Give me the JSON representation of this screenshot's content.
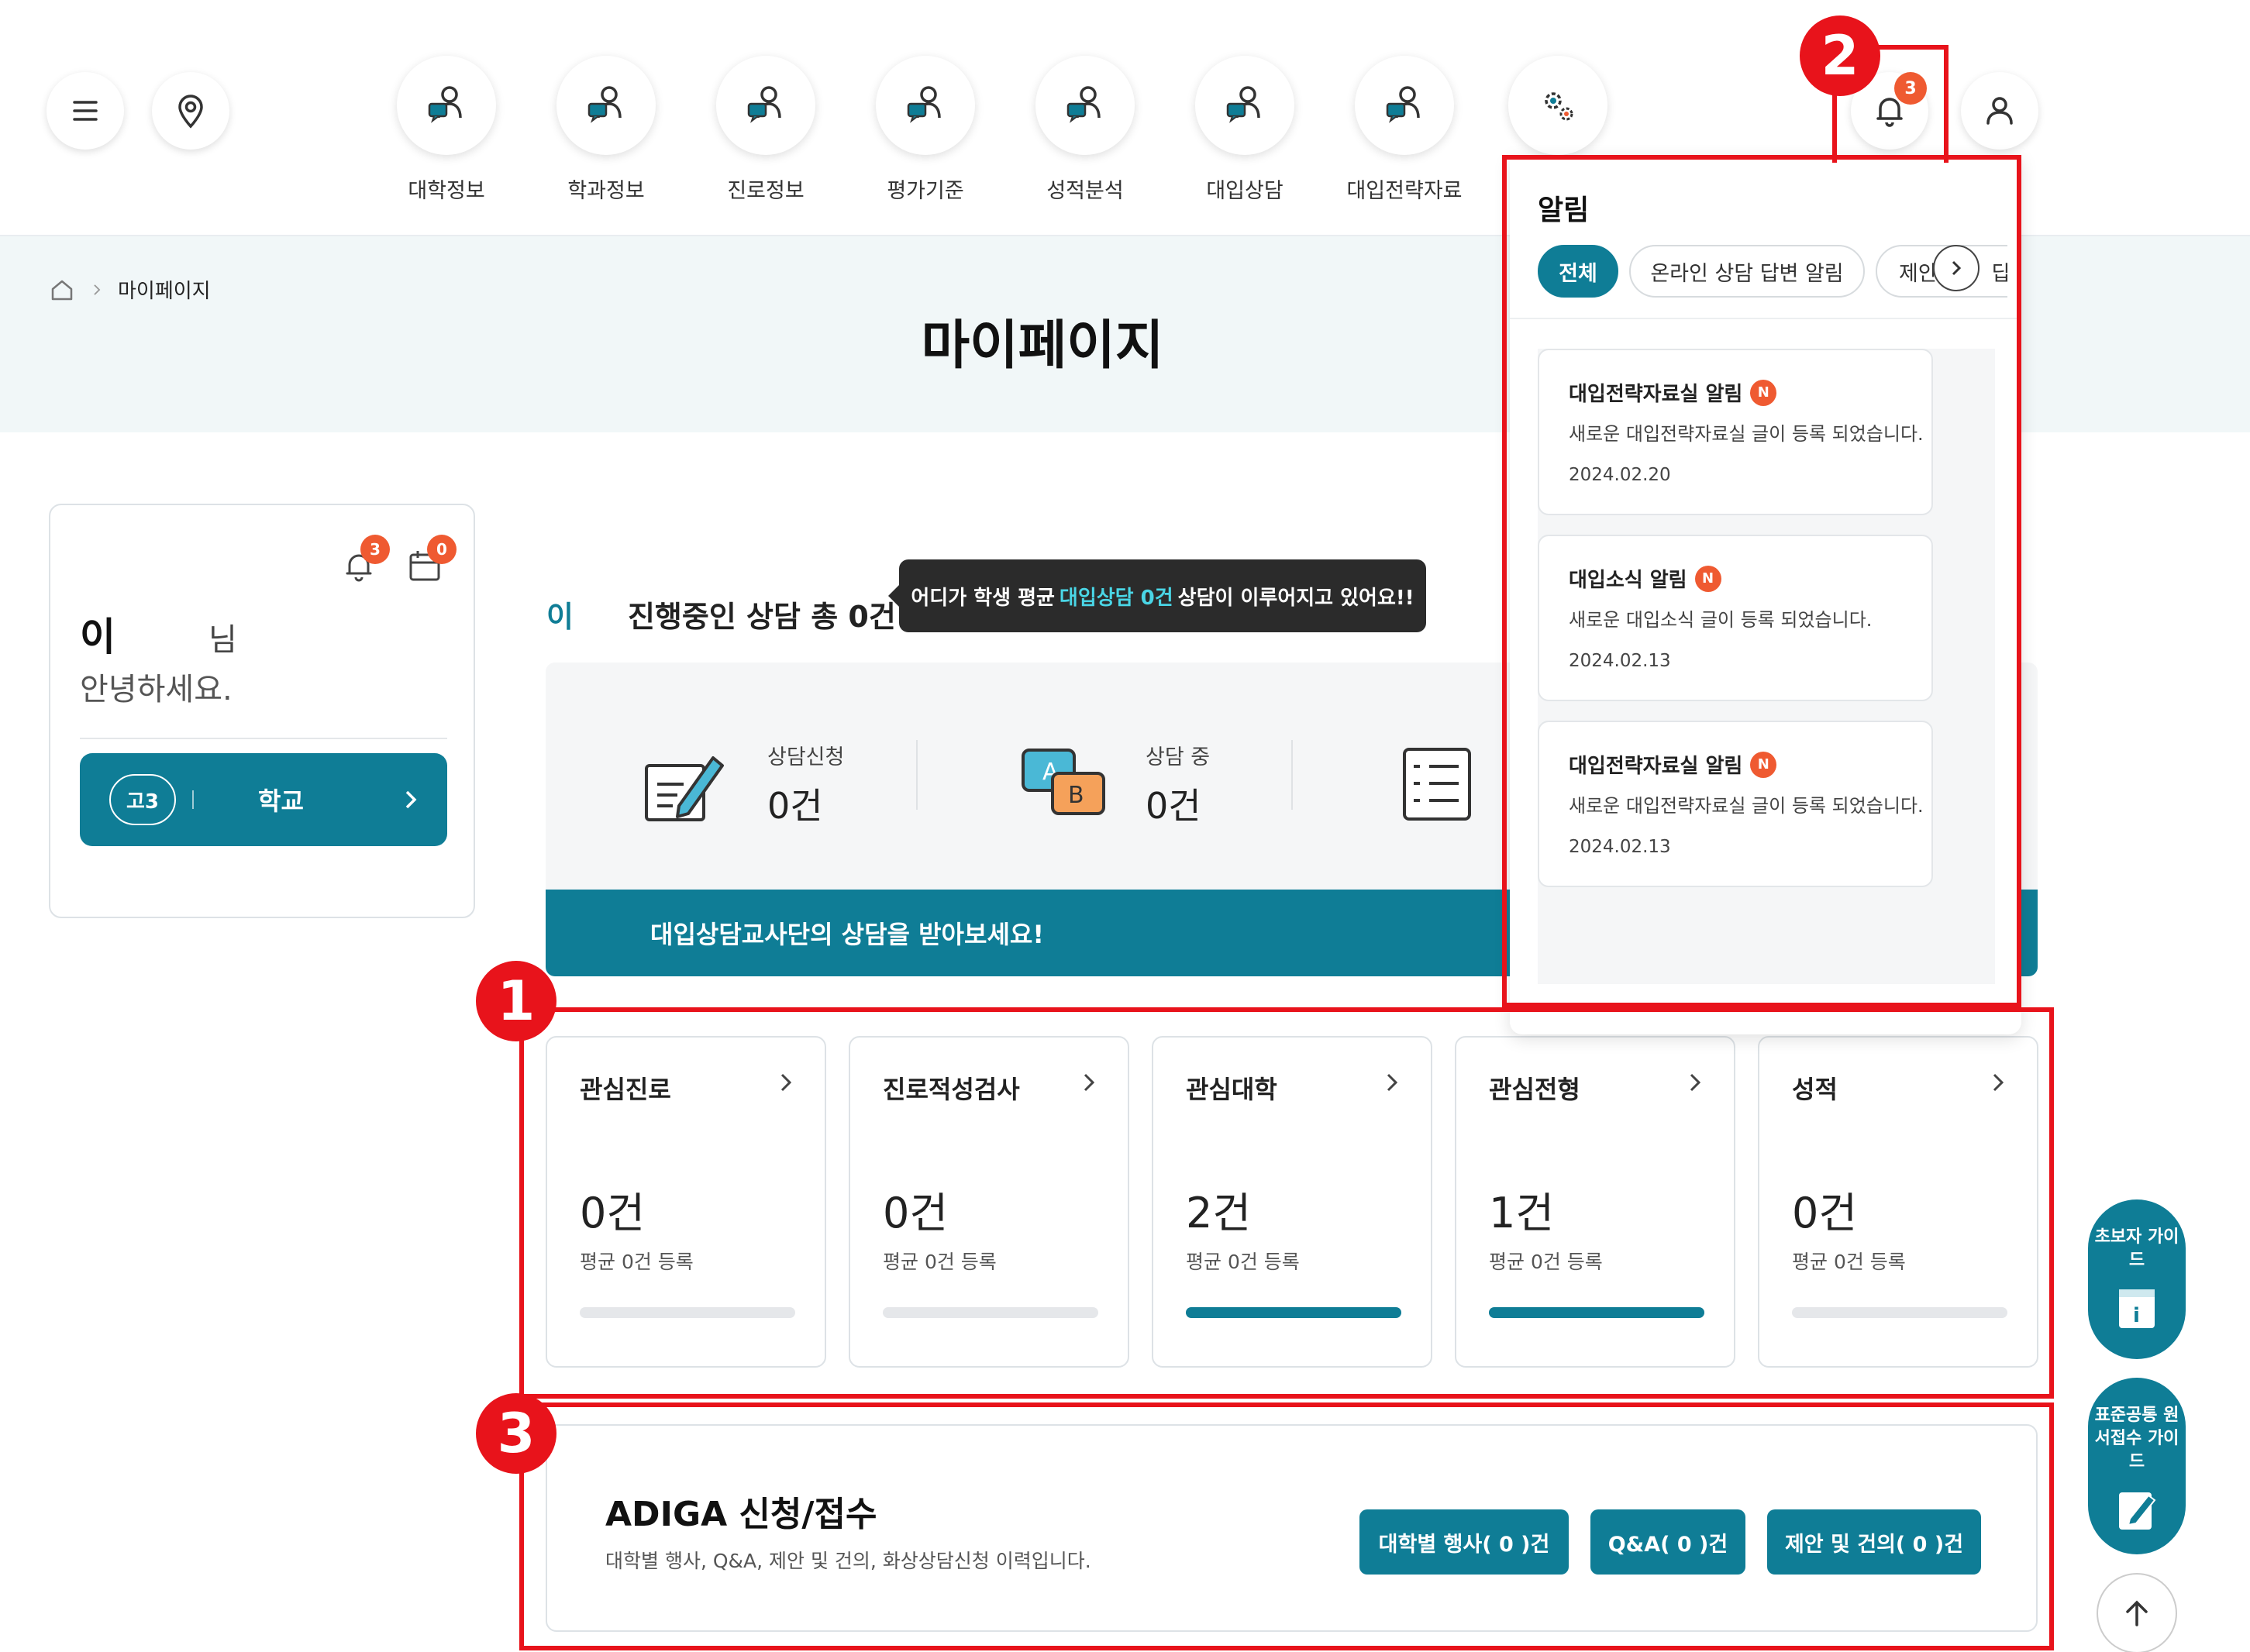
{
  "header": {
    "nav": [
      {
        "label": "대학정보",
        "icon": "counselor-icon"
      },
      {
        "label": "학과정보",
        "icon": "counselor-icon"
      },
      {
        "label": "진로정보",
        "icon": "counselor-icon"
      },
      {
        "label": "평가기준",
        "icon": "counselor-icon"
      },
      {
        "label": "성적분석",
        "icon": "counselor-icon"
      },
      {
        "label": "대입상담",
        "icon": "counselor-icon"
      },
      {
        "label": "대입전략자료",
        "icon": "counselor-icon"
      }
    ],
    "notification_badge": "3",
    "icons": {
      "menu": "hamburger-icon",
      "location": "location-pin-icon",
      "settings": "gears-icon",
      "bell": "bell-icon",
      "user": "user-icon"
    }
  },
  "breadcrumb": {
    "current": "마이페이지"
  },
  "page": {
    "title": "마이페이지"
  },
  "profile": {
    "bell_badge": "3",
    "calendar_badge": "0",
    "name": "이",
    "suffix": "님",
    "greeting": "안녕하세요.",
    "grade": "고3",
    "school": "학교"
  },
  "counsel": {
    "lead": "이",
    "total_text": "진행중인 상담 총 0건",
    "tooltip": {
      "prefix": "어디가 학생 평균",
      "highlight": "대입상담 0건",
      "suffix": "상담이 이루어지고 있어요!!"
    },
    "stats": [
      {
        "label": "상담신청",
        "value": "0건"
      },
      {
        "label": "상담 중",
        "value": "0건"
      }
    ],
    "banner": "대입상담교사단의 상담을 받아보세요!"
  },
  "cards": [
    {
      "title": "관심진로",
      "count": "0건",
      "avg": "평균 0건 등록",
      "progress": 0
    },
    {
      "title": "진로적성검사",
      "count": "0건",
      "avg": "평균 0건 등록",
      "progress": 0
    },
    {
      "title": "관심대학",
      "count": "2건",
      "avg": "평균 0건 등록",
      "progress": 1
    },
    {
      "title": "관심전형",
      "count": "1건",
      "avg": "평균 0건 등록",
      "progress": 1
    },
    {
      "title": "성적",
      "count": "0건",
      "avg": "평균 0건 등록",
      "progress": 0
    }
  ],
  "adiga": {
    "title": "ADIGA 신청/접수",
    "desc": "대학별 행사, Q&A, 제안 및 건의, 화상상담신청 이력입니다.",
    "buttons": [
      "대학별 행사( 0 )건",
      "Q&A( 0 )건",
      "제안 및 건의( 0 )건"
    ]
  },
  "notifications": {
    "title": "알림",
    "tabs": [
      "전체",
      "온라인 상담 답변 알림",
      "제안 및 건의 답변"
    ],
    "tab_partial": [
      "제안",
      "답변"
    ],
    "new_badge": "N",
    "items": [
      {
        "title": "대입전략자료실 알림",
        "body": "새로운 대입전략자료실 글이 등록 되었습니다.",
        "date": "2024.02.20"
      },
      {
        "title": "대입소식 알림",
        "body": "새로운 대입소식 글이 등록 되었습니다.",
        "date": "2024.02.13"
      },
      {
        "title": "대입전략자료실 알림",
        "body": "새로운 대입전략자료실 글이 등록 되었습니다.",
        "date": "2024.02.13"
      }
    ]
  },
  "annotations": [
    "1",
    "2",
    "3"
  ],
  "floating": [
    {
      "label": "초보자 가이드"
    },
    {
      "label": "표준공통 원서접수 가이드"
    }
  ],
  "colors": {
    "primary": "#0f7d96",
    "badge": "#ef5a31",
    "annotation": "#e8131b"
  }
}
